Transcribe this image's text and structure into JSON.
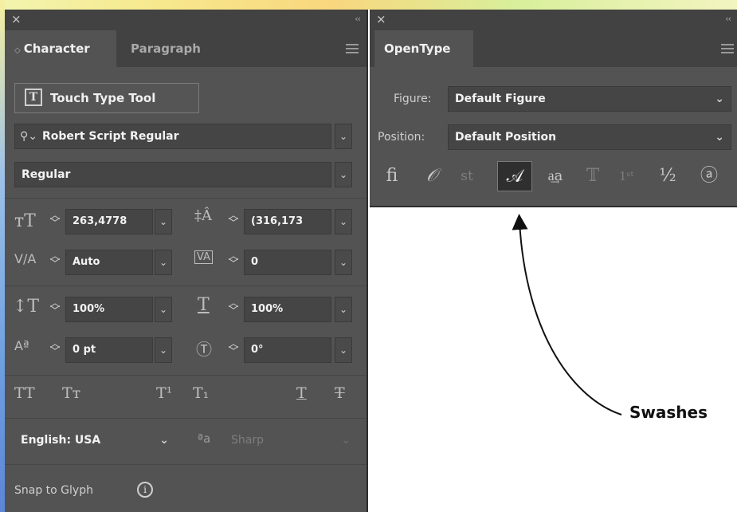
{
  "character_panel": {
    "close": "×",
    "collapse": "‹‹",
    "tabs": [
      {
        "label": "Character",
        "active": true
      },
      {
        "label": "Paragraph",
        "active": false
      }
    ],
    "touch_type_tool": "Touch Type Tool",
    "font_family": "Robert Script Regular",
    "font_style": "Regular",
    "font_size": "263,4778",
    "leading": "(316,173",
    "kerning": "Auto",
    "tracking": "0",
    "vertical_scale": "100%",
    "horizontal_scale": "100%",
    "baseline_shift": "0 pt",
    "rotation": "0°",
    "type_styles": {
      "all_caps": "TT",
      "small_caps": "Tт",
      "superscript": "T¹",
      "subscript": "T₁",
      "underline": "T",
      "strikethrough": "T"
    },
    "language": "English: USA",
    "aa_icon": "ªa",
    "anti_aliasing": "Sharp",
    "snap_to_glyph": "Snap to Glyph"
  },
  "opentype_panel": {
    "close": "×",
    "collapse": "‹‹",
    "tab": "OpenType",
    "figure_label": "Figure:",
    "figure_value": "Default Figure",
    "position_label": "Position:",
    "position_value": "Default Position",
    "glyph_buttons": [
      {
        "glyph": "ﬁ",
        "name": "standard-ligatures",
        "state": "normal"
      },
      {
        "glyph": "𝒪",
        "name": "contextual-alternates",
        "state": "normal"
      },
      {
        "glyph": "st",
        "name": "discretionary-ligatures",
        "state": "dim"
      },
      {
        "glyph": "𝒜",
        "name": "swash",
        "state": "selected"
      },
      {
        "glyph": "a͢a",
        "name": "stylistic-alternates",
        "state": "normal"
      },
      {
        "glyph": "𝕋",
        "name": "titling-alternates",
        "state": "dim"
      },
      {
        "glyph": "1ˢᵗ",
        "name": "ordinals",
        "state": "dim"
      },
      {
        "glyph": "½",
        "name": "fractions",
        "state": "normal"
      },
      {
        "glyph": "ⓐ",
        "name": "stylistic-sets",
        "state": "normal"
      }
    ]
  },
  "annotation": {
    "label": "Swashes"
  },
  "colors": {
    "panel_bg": "#535353",
    "titlebar_bg": "#424242",
    "field_bg": "#454545",
    "selected_glyph_bg": "#2f2f2f"
  }
}
